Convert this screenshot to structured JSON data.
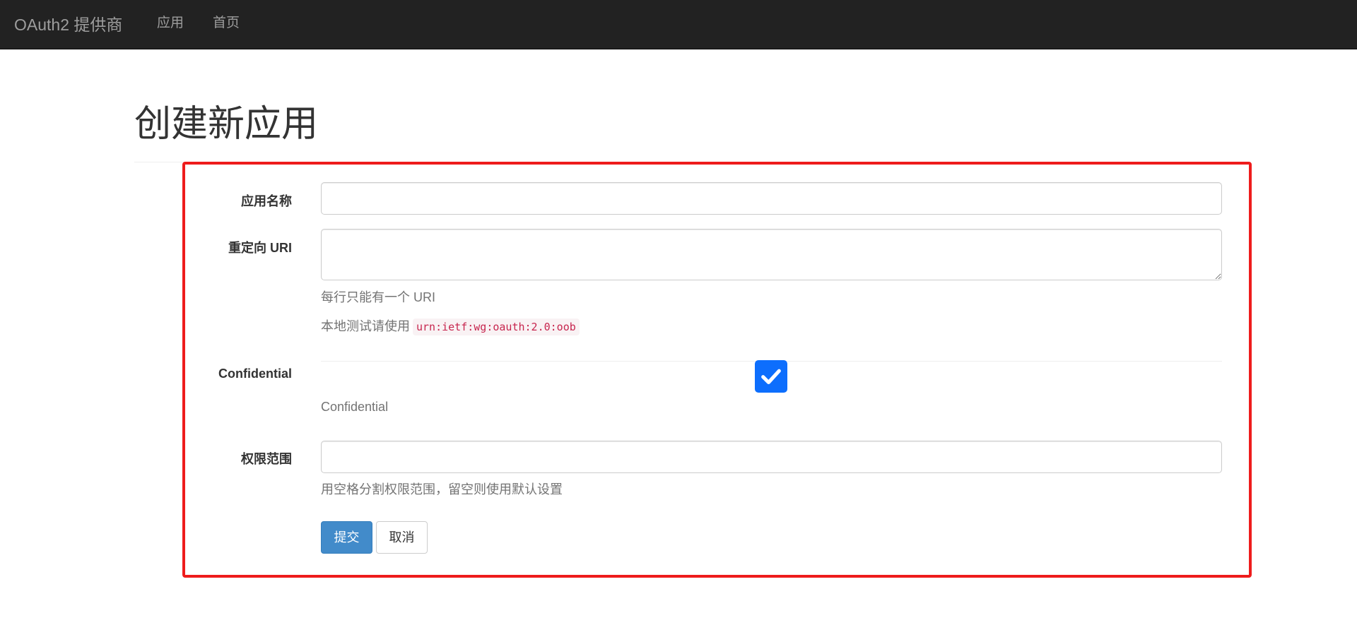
{
  "navbar": {
    "brand": "OAuth2 提供商",
    "links": [
      "应用",
      "首页"
    ]
  },
  "page": {
    "title": "创建新应用"
  },
  "form": {
    "app_name": {
      "label": "应用名称",
      "value": ""
    },
    "redirect_uri": {
      "label": "重定向 URI",
      "value": "",
      "help_line1": "每行只能有一个 URI",
      "help_line2": "本地测试请使用",
      "help_code": "urn:ietf:wg:oauth:2.0:oob"
    },
    "confidential": {
      "label": "Confidential",
      "checked": true,
      "help": "Confidential",
      "color": "#0d6efd"
    },
    "scopes": {
      "label": "权限范围",
      "value": "",
      "help": "用空格分割权限范围，留空则使用默认设置"
    },
    "buttons": {
      "submit": "提交",
      "cancel": "取消"
    }
  },
  "colors": {
    "navbar_bg": "#222222",
    "highlight_border": "#ee1c1c",
    "primary": "#428bca"
  }
}
